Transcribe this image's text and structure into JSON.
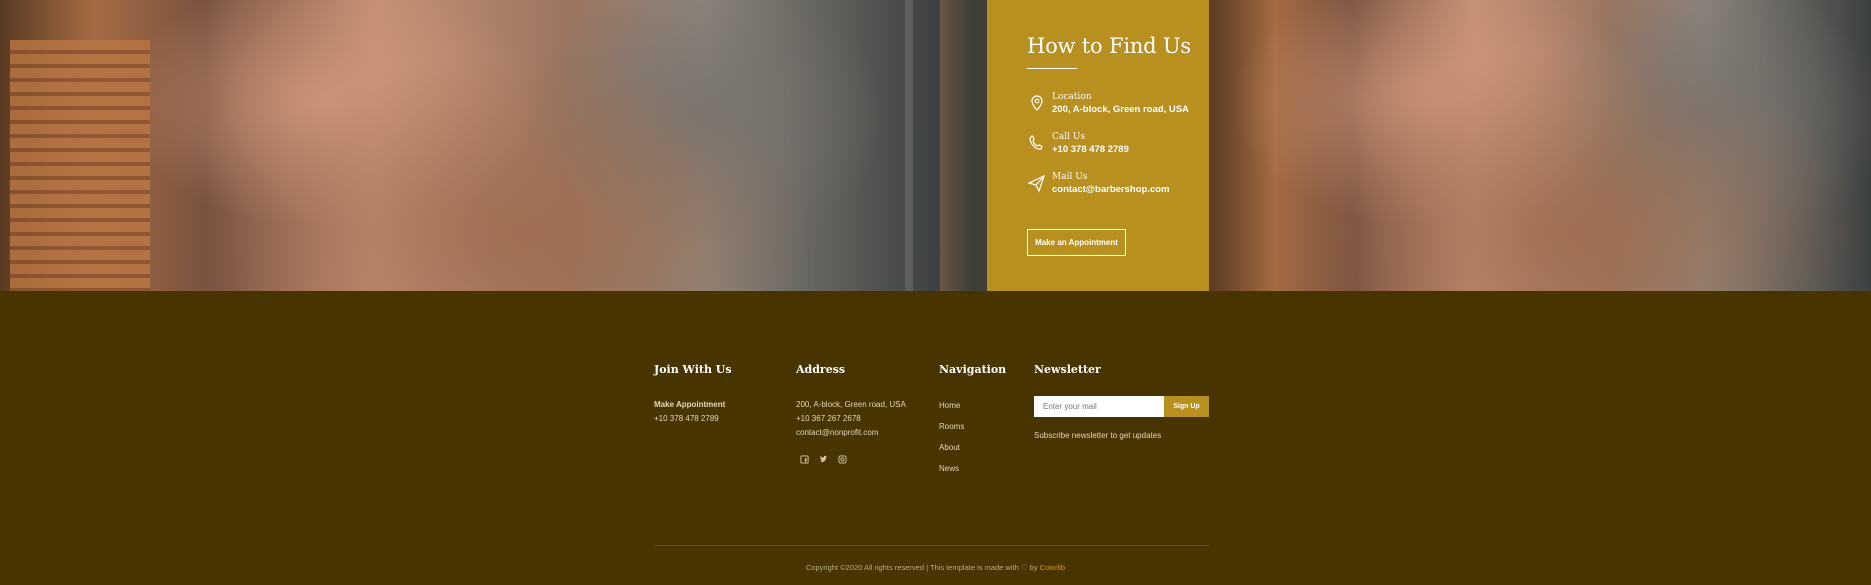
{
  "hero": {
    "find_us": {
      "title": "How to Find Us",
      "location": {
        "label": "Location",
        "value": "200, A-block, Green road, USA"
      },
      "call": {
        "label": "Call Us",
        "value": "+10 378 478 2789"
      },
      "mail": {
        "label": "Mail Us",
        "value": "contact@barbershop.com"
      },
      "cta": "Make an Appointment"
    }
  },
  "footer": {
    "join": {
      "title": "Join With Us",
      "line1": "Make Appointment",
      "line2": "+10 378 478 2789"
    },
    "address": {
      "title": "Address",
      "line1": "200, A-block, Green road, USA",
      "line2": "+10 367 267 2678",
      "line3": "contact@nonprofit.com"
    },
    "navigation": {
      "title": "Navigation",
      "items": [
        "Home",
        "Rooms",
        "About",
        "News"
      ]
    },
    "newsletter": {
      "title": "Newsletter",
      "placeholder": "Enter your mail",
      "button": "Sign Up",
      "note": "Subscribe newsletter to get updates"
    },
    "social_icons": [
      "facebook-icon",
      "twitter-icon",
      "instagram-icon"
    ],
    "copyright": {
      "text": "Copyright ©2020 All rights reserved | This template is made with ♡ by ",
      "brand": "Colorlib"
    }
  },
  "colors": {
    "gold": "#b89020",
    "footer_bg": "#473400",
    "brand_link": "#d39a22"
  }
}
